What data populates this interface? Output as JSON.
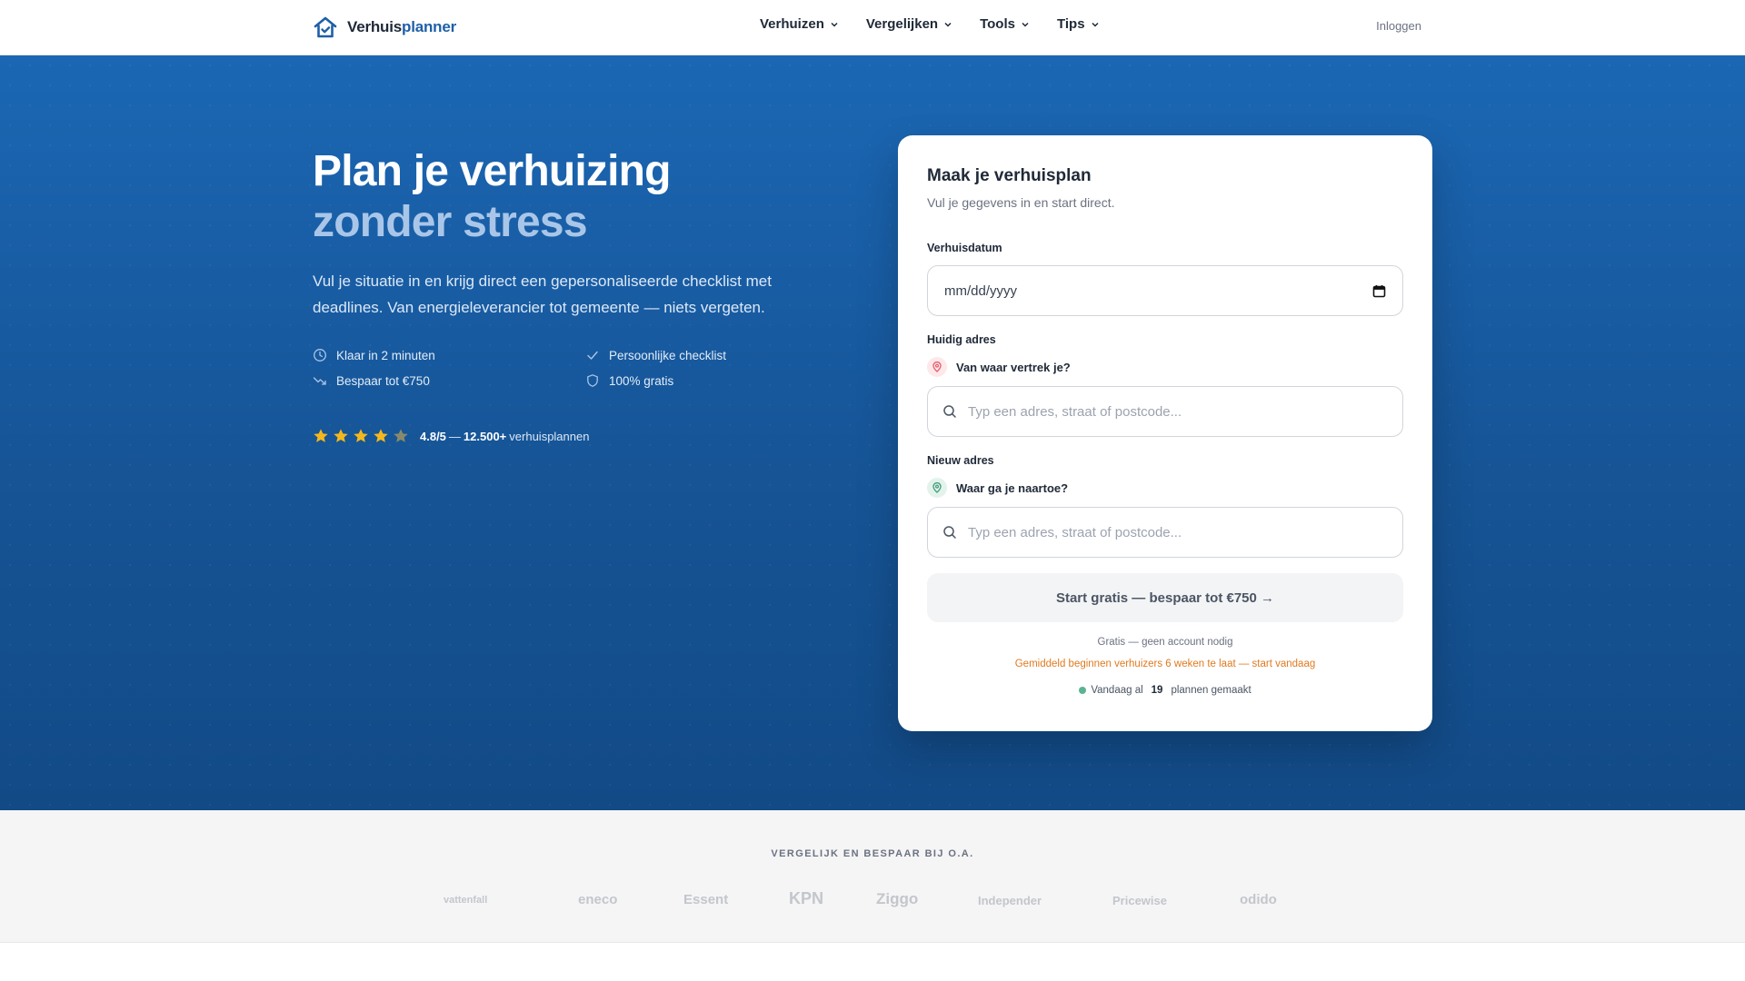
{
  "header": {
    "logo_part1": "Verhuis",
    "logo_part2": "planner",
    "nav": [
      "Verhuizen",
      "Vergelijken",
      "Tools",
      "Tips"
    ],
    "login": "Inloggen",
    "icons": {
      "logo": "house-check-icon",
      "dropdown": "chevron-down-icon"
    }
  },
  "hero": {
    "title_main": "Plan je verhuizing ",
    "title_accent": "zonder stress",
    "subtitle": "Vul je situatie in en krijg direct een gepersonaliseerde checklist met deadlines. Van energieleverancier tot gemeente — niets vergeten.",
    "features": [
      {
        "icon": "clock-icon",
        "label": "Klaar in 2 minuten"
      },
      {
        "icon": "check-icon",
        "label": "Persoonlijke checklist"
      },
      {
        "icon": "trend-down-icon",
        "label": "Bespaar tot €750"
      },
      {
        "icon": "shield-icon",
        "label": "100% gratis"
      }
    ],
    "rating": {
      "stars": 4,
      "stars_max": 5,
      "score": "4.8/5",
      "separator": " — ",
      "count": "12.500+",
      "suffix": " verhuisplannen"
    }
  },
  "form": {
    "title": "Maak je verhuisplan",
    "subtitle": "Vul je gegevens in en start direct.",
    "date_label": "Verhuisdatum",
    "date_value": "mm/dd/yyyy",
    "current_label": "Huidig adres",
    "current_question": "Van waar vertrek je?",
    "current_placeholder": "Typ een adres, straat of postcode...",
    "new_label": "Nieuw adres",
    "new_question": "Waar ga je naartoe?",
    "new_placeholder": "Typ een adres, straat of postcode...",
    "cta": "Start gratis — bespaar tot €750 →",
    "note": "Gratis — geen account nodig",
    "warning": "Gemiddeld beginnen verhuizers 6 weken te laat — start vandaag",
    "counter_prefix": "Vandaag al",
    "counter_value": "19",
    "counter_suffix": "plannen gemaakt",
    "colors": {
      "origin_pin": "#e35d6a",
      "destination_pin": "#3f9a77",
      "warning": "#e07a1f"
    }
  },
  "brands": {
    "heading": "VERGELIJK EN BESPAAR BIJ O.A.",
    "items": [
      "vattenfall",
      "eneco",
      "Essent",
      "KPN",
      "Ziggo",
      "Independer",
      "Pricewise",
      "odido"
    ]
  }
}
